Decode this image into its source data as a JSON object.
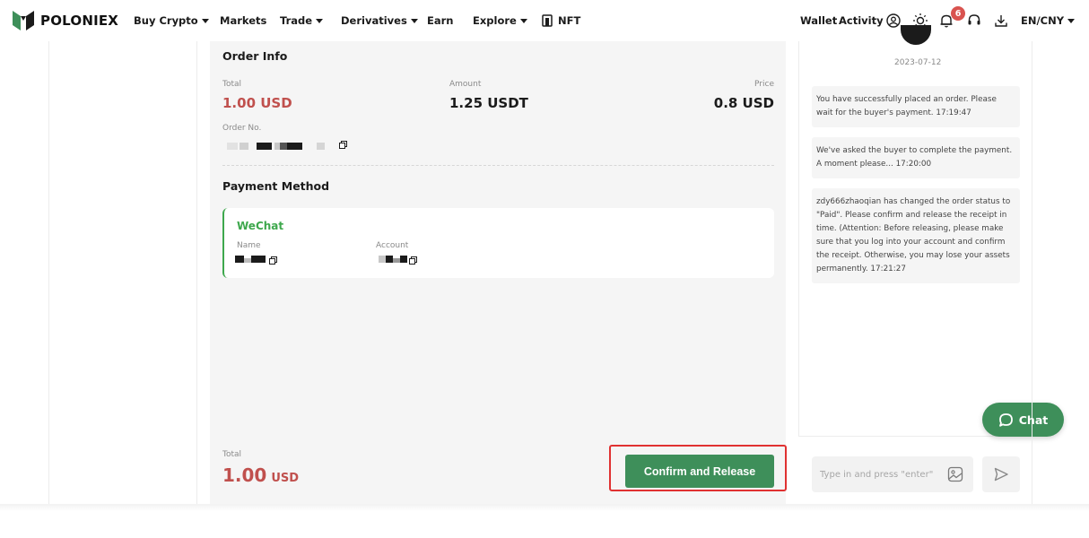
{
  "nav": {
    "brand": "POLONIEX",
    "buy_crypto": "Buy Crypto",
    "markets": "Markets",
    "trade": "Trade",
    "derivatives": "Derivatives",
    "earn": "Earn",
    "explore": "Explore",
    "nft": "NFT",
    "wallet": "Wallet",
    "activity": "Activity",
    "notification_count": "6",
    "language": "EN/CNY",
    "icons": [
      "user-icon",
      "theme-icon",
      "bell-icon",
      "support-icon",
      "download-icon"
    ]
  },
  "order_info": {
    "title": "Order Info",
    "total_label": "Total",
    "total_value": "1.00 USD",
    "amount_label": "Amount",
    "amount_value": "1.25 USDT",
    "price_label": "Price",
    "price_value": "0.8 USD",
    "order_no_label": "Order No."
  },
  "payment": {
    "title": "Payment Method",
    "method": "WeChat",
    "name_label": "Name",
    "account_label": "Account"
  },
  "footer": {
    "total_label": "Total",
    "total_amount": "1.00",
    "total_currency": "USD",
    "confirm_label": "Confirm and Release"
  },
  "chat": {
    "date": "2023-07-12",
    "messages": [
      "You have successfully placed an order. Please wait for the buyer's payment. 17:19:47",
      "We've asked the buyer to complete the payment. A moment please... 17:20:00",
      "zdy666zhaoqian has changed the order status to \"Paid\". Please confirm and release the receipt in time. (Attention: Before releasing, please make sure that you log into your account and confirm the receipt. Otherwise, you may lose your assets permanently. 17:21:27"
    ],
    "input_placeholder": "Type in and press \"enter\"",
    "float_label": "Chat"
  },
  "colors": {
    "accent_green": "#3e8f5a",
    "wechat_green": "#3ea84d",
    "price_red": "#c0504d",
    "highlight_red": "#e03131"
  }
}
